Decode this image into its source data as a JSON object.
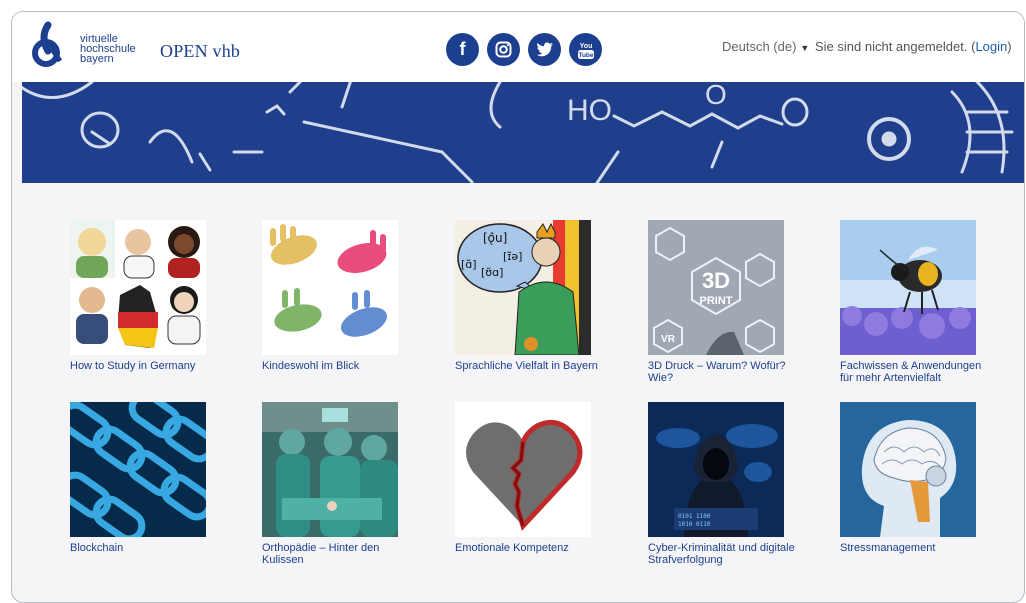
{
  "header": {
    "logo_lines": [
      "virtuelle",
      "hochschule",
      "bayern"
    ],
    "brand": "OPEN vhb",
    "social": [
      {
        "icon": "facebook-icon",
        "glyph": "f"
      },
      {
        "icon": "instagram-icon",
        "glyph": "◎"
      },
      {
        "icon": "twitter-icon",
        "glyph": "🐦"
      },
      {
        "icon": "youtube-icon",
        "glyph": "You Tube"
      }
    ],
    "language": "Deutsch (de)",
    "status_text": "Sie sind nicht angemeldet. (",
    "login_label": "Login",
    "status_close": ")"
  },
  "courses": [
    {
      "title": "How to Study in Germany"
    },
    {
      "title": "Kindeswohl im Blick"
    },
    {
      "title": "Sprachliche Vielfalt in Bayern"
    },
    {
      "title": "3D Druck – Warum? Wofür? Wie?"
    },
    {
      "title": "Fachwissen & Anwendungen für mehr Artenvielfalt"
    },
    {
      "title": "Blockchain"
    },
    {
      "title": "Orthopädie – Hinter den Kulissen"
    },
    {
      "title": "Emotionale Kompetenz"
    },
    {
      "title": "Cyber-Kriminalität und digitale Strafverfolgung"
    },
    {
      "title": "Stressmanagement"
    }
  ],
  "colors": {
    "brand": "#1d3f8f",
    "banner": "#1f3f8c",
    "link": "#1d5fb4"
  }
}
